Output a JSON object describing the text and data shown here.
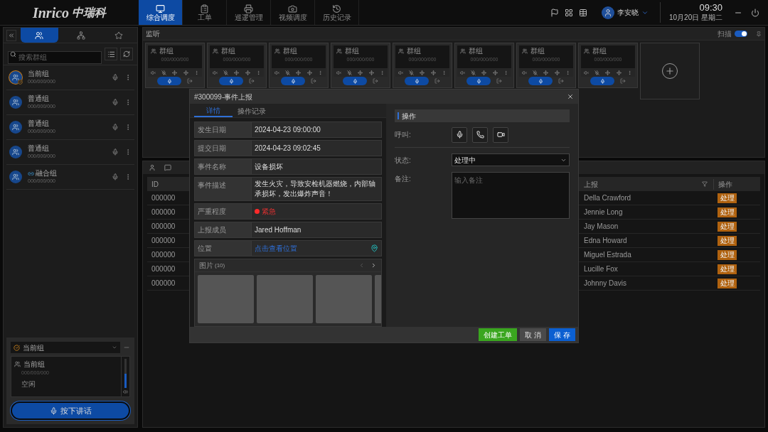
{
  "top_bar": {
    "logo_latin": "Inrico",
    "logo_cn": "中瑞科",
    "user": "李安晓",
    "time": "09:30",
    "date": "10月20日 星期二",
    "nav": [
      {
        "label": "综合调度",
        "kind": "dispatch",
        "selected": true
      },
      {
        "label": "工单",
        "kind": "orders",
        "selected": false
      },
      {
        "label": "巡逻管理",
        "kind": "patrol",
        "selected": false
      },
      {
        "label": "视频调度",
        "kind": "video",
        "selected": false
      },
      {
        "label": "历史记录",
        "kind": "history",
        "selected": false
      }
    ]
  },
  "sidebar": {
    "tabs": [
      {
        "kind": "groups",
        "selected": true
      },
      {
        "kind": "tree",
        "selected": false
      },
      {
        "kind": "favorites",
        "selected": false
      }
    ],
    "search": {
      "placeholder": "搜索群组"
    },
    "groups": [
      {
        "name": "当前组",
        "code": "000/000/000",
        "kind": "current"
      },
      {
        "name": "普通组",
        "code": "000/000/000",
        "kind": "normal"
      },
      {
        "name": "普通组",
        "code": "000/000/000",
        "kind": "normal"
      },
      {
        "name": "普通组",
        "code": "000/000/000",
        "kind": "normal"
      },
      {
        "name": "融合组",
        "code": "000/000/000",
        "kind": "fused"
      }
    ],
    "current_panel": {
      "selector": "当前组",
      "name": "当前组",
      "code": "000/000/000",
      "status": "空闲",
      "volume": {
        "level": 0.5
      },
      "ptt": "按下讲话"
    }
  },
  "monitor": {
    "title": "监听",
    "toggle": {
      "label": "扫描",
      "on": true
    },
    "tiles": [
      {
        "name": "群组",
        "code": "000/000/000"
      },
      {
        "name": "群组",
        "code": "000/000/000"
      },
      {
        "name": "群组",
        "code": "000/000/000"
      },
      {
        "name": "群组",
        "code": "000/000/000"
      },
      {
        "name": "群组",
        "code": "000/000/000"
      },
      {
        "name": "群组",
        "code": "000/000/000"
      },
      {
        "name": "群组",
        "code": "000/000/000"
      },
      {
        "name": "群组",
        "code": "000/000/000"
      }
    ]
  },
  "events_table": {
    "columns": [
      "ID",
      "上报",
      "操作"
    ],
    "rows": [
      {
        "id": "000000",
        "reporter": "Della Crawford",
        "action": "处理"
      },
      {
        "id": "000000",
        "reporter": "Jennie Long",
        "action": "处理"
      },
      {
        "id": "000000",
        "reporter": "Jay Mason",
        "action": "处理"
      },
      {
        "id": "000000",
        "reporter": "Edna Howard",
        "action": "处理"
      },
      {
        "id": "000000",
        "reporter": "Miguel Estrada",
        "action": "处理"
      },
      {
        "id": "000000",
        "reporter": "Lucille Fox",
        "action": "处理"
      },
      {
        "id": "000000",
        "reporter": "Johnny Davis",
        "action": "处理"
      }
    ]
  },
  "dialog": {
    "title": "#300099-事件上报",
    "tabs": [
      {
        "label": "详情",
        "selected": true
      },
      {
        "label": "操作记录",
        "selected": false
      }
    ],
    "fields": [
      {
        "label": "发生日期",
        "value": "2024-04-23 09:00:00",
        "kind": "text"
      },
      {
        "label": "提交日期",
        "value": "2024-04-23 09:02:45",
        "kind": "text"
      },
      {
        "label": "事件名称",
        "value": "设备损坏",
        "kind": "text"
      },
      {
        "label": "事件描述",
        "value": "发生火灾，导致安检机器燃烧，内部轴承损坏，发出爆炸声音！",
        "kind": "text"
      },
      {
        "label": "严重程度",
        "value": "紧急",
        "kind": "severity"
      },
      {
        "label": "上报成员",
        "value": "Jared Hoffman",
        "kind": "text"
      },
      {
        "label": "位置",
        "value": "点击查看位置",
        "kind": "location"
      }
    ],
    "photos": {
      "title": "图片",
      "count": "(10)",
      "thumbnails": [
        {
          "kind": "placeholder"
        },
        {
          "kind": "placeholder"
        },
        {
          "kind": "placeholder"
        },
        {
          "kind": "placeholder"
        }
      ]
    },
    "actions": {
      "title": "操作",
      "call_label": "呼叫:",
      "call_buttons": [
        {
          "kind": "ptt"
        },
        {
          "kind": "phone"
        },
        {
          "kind": "video"
        }
      ],
      "status_label": "状态:",
      "status_value": "处理中",
      "note_label": "备注:",
      "note_placeholder": "输入备注"
    },
    "buttons": [
      {
        "label": "创建工单",
        "kind": "create"
      },
      {
        "label": "取 消",
        "kind": "cancel"
      },
      {
        "label": "保 存",
        "kind": "save"
      }
    ]
  }
}
